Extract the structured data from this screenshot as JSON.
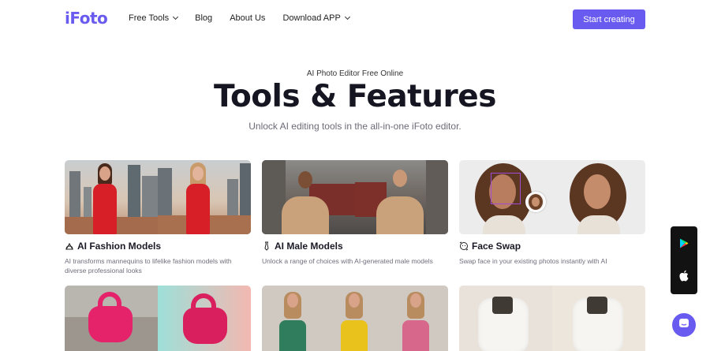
{
  "header": {
    "logo": "iFoto",
    "nav": [
      {
        "label": "Free Tools",
        "dropdown": true
      },
      {
        "label": "Blog",
        "dropdown": false
      },
      {
        "label": "About Us",
        "dropdown": false
      },
      {
        "label": "Download APP",
        "dropdown": true
      }
    ],
    "cta_label": "Start creating"
  },
  "hero": {
    "eyebrow": "AI Photo Editor Free Online",
    "title": "Tools & Features",
    "subtitle": "Unlock AI editing tools in the all-in-one iFoto editor."
  },
  "cards": [
    {
      "title": "AI Fashion Models",
      "desc": "AI transforms mannequins to lifelike fashion models with diverse professional looks",
      "icon": "hanger-icon"
    },
    {
      "title": "AI Male Models",
      "desc": "Unlock a range of choices with AI-generated male models",
      "icon": "tie-icon"
    },
    {
      "title": "Face Swap",
      "desc": "Swap face in your existing photos instantly with AI",
      "icon": "face-swap-icon"
    },
    {
      "title": "",
      "desc": "",
      "icon": ""
    },
    {
      "title": "",
      "desc": "",
      "icon": ""
    },
    {
      "title": "",
      "desc": "",
      "icon": ""
    }
  ],
  "floating": {
    "app_icons": [
      "google-play-icon",
      "apple-icon"
    ],
    "chat_icon": "chat-icon"
  },
  "colors": {
    "accent": "#6a5bf0",
    "app_bar": "#121212"
  }
}
